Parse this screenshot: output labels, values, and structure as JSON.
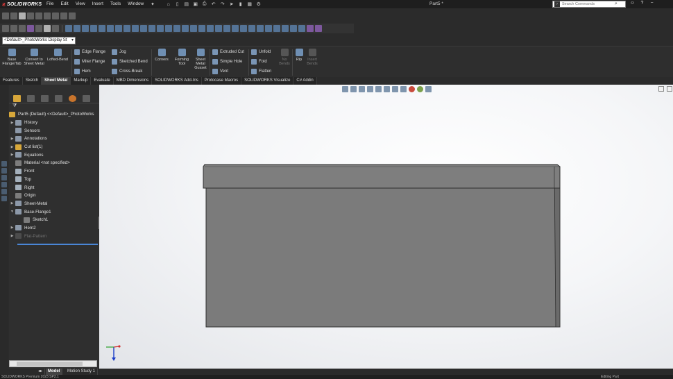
{
  "app": {
    "brand": "SOLIDWORKS",
    "doc_title": "Part5 *"
  },
  "menu": [
    "File",
    "Edit",
    "View",
    "Insert",
    "Tools",
    "Window"
  ],
  "search": {
    "placeholder": "Search Commands"
  },
  "config_selector": {
    "value": "<Default>_PhotoWorks Display St"
  },
  "command_manager": {
    "base_flange": "Base Flange/Tab",
    "convert": "Convert to Sheet Metal",
    "lofted_bend": "Lofted-Bend",
    "edge_flange": "Edge Flange",
    "miter_flange": "Miter Flange",
    "hem": "Hem",
    "jog": "Jog",
    "sketched_bend": "Sketched Bend",
    "cross_break": "Cross-Break",
    "corners": "Corners",
    "forming_tool": "Forming Tool",
    "gusset": "Sheet Metal Gusset",
    "extruded_cut": "Extruded Cut",
    "simple_hole": "Simple Hole",
    "vent": "Vent",
    "unfold": "Unfold",
    "fold": "Fold",
    "flatten": "Flatten",
    "no_bends": "No Bends",
    "rip": "Rip",
    "insert_bends": "Insert Bends"
  },
  "tabs": [
    "Features",
    "Sketch",
    "Sheet Metal",
    "Markup",
    "Evaluate",
    "MBD Dimensions",
    "SOLIDWORKS Add-Ins",
    "Protocase Macros",
    "SOLIDWORKS Visualize",
    "C# Addin"
  ],
  "active_tab": "Sheet Metal",
  "feature_tree": {
    "root": "Part5 (Default) <<Default>_PhotoWorks",
    "items": [
      {
        "label": "History"
      },
      {
        "label": "Sensors"
      },
      {
        "label": "Annotations"
      },
      {
        "label": "Cut list(1)"
      },
      {
        "label": "Equations"
      },
      {
        "label": "Material <not specified>"
      },
      {
        "label": "Front"
      },
      {
        "label": "Top"
      },
      {
        "label": "Right"
      },
      {
        "label": "Origin"
      },
      {
        "label": "Sheet-Metal"
      },
      {
        "label": "Base-Flange1"
      },
      {
        "label": "Sketch1"
      },
      {
        "label": "Hem2"
      },
      {
        "label": "Flat-Pattern"
      }
    ]
  },
  "bottom_tabs": [
    "Model",
    "Motion Study 1"
  ],
  "status": {
    "left": "SOLIDWORKS Premium 2023 SP2.1",
    "right": "Editing Part"
  },
  "colors": {
    "accent": "#4a86d6",
    "part_face": "#7b7b7b",
    "part_edge": "#2d2d2d"
  }
}
